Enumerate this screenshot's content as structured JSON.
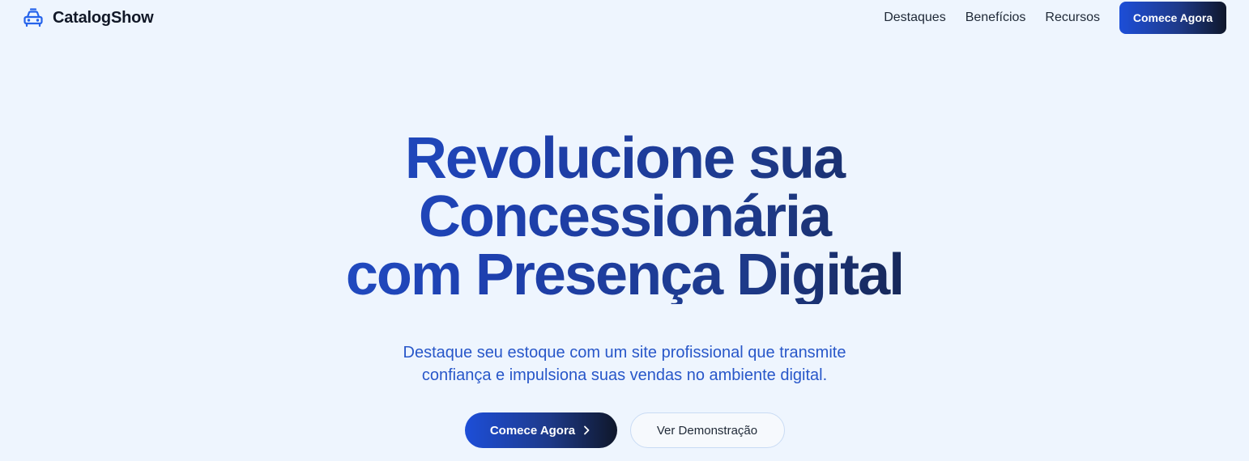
{
  "header": {
    "brand_name": "CatalogShow",
    "brand_icon": "car-icon",
    "nav": [
      {
        "label": "Destaques"
      },
      {
        "label": "Benefícios"
      },
      {
        "label": "Recursos"
      }
    ],
    "cta_label": "Comece Agora"
  },
  "hero": {
    "title_lines": [
      "Revolucione sua",
      "Concessionária",
      "com Presença Digital"
    ],
    "subtitle_lines": [
      "Destaque seu estoque com um site profissional que transmite",
      "confiança e impulsiona suas vendas no ambiente digital."
    ],
    "primary_button": "Comece Agora",
    "primary_icon": "chevron-right-icon",
    "secondary_button": "Ver Demonstração"
  },
  "colors": {
    "background": "#eef5fe",
    "accent_blue": "#2563eb",
    "accent_dark": "#0f172a",
    "subtitle": "#2857c9"
  }
}
